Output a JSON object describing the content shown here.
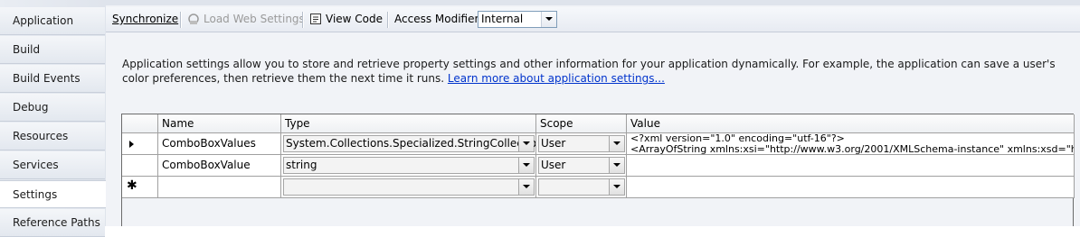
{
  "sidebar": {
    "items": [
      {
        "label": "Application"
      },
      {
        "label": "Build"
      },
      {
        "label": "Build Events"
      },
      {
        "label": "Debug"
      },
      {
        "label": "Resources"
      },
      {
        "label": "Services"
      },
      {
        "label": "Settings",
        "active": true
      },
      {
        "label": "Reference Paths"
      }
    ]
  },
  "toolbar": {
    "synchronize": "Synchronize",
    "load_web_settings": "Load Web Settings",
    "view_code": "View Code",
    "access_modifier_label": "Access Modifier:",
    "access_modifier_value": "Internal"
  },
  "description": {
    "text": "Application settings allow you to store and retrieve property settings and other information for your application dynamically. For example, the application can save a user's color preferences, then retrieve them the next time it runs.",
    "link": "Learn more about application settings..."
  },
  "grid": {
    "headers": {
      "name": "Name",
      "type": "Type",
      "scope": "Scope",
      "value": "Value"
    },
    "rows": [
      {
        "name": "ComboBoxValues",
        "type": "System.Collections.Specialized.StringCollection",
        "scope": "User",
        "value_line1": "<?xml version=\"1.0\" encoding=\"utf-16\"?>",
        "value_line2": "<ArrayOfString xmlns:xsi=\"http://www.w3.org/2001/XMLSchema-instance\" xmlns:xsd=\"ht"
      },
      {
        "name": "ComboBoxValue",
        "type": "string",
        "scope": "User",
        "value_line1": "",
        "value_line2": ""
      }
    ],
    "new_row_marker": "✱"
  },
  "colors": {
    "link": "#0033cc",
    "sidebar_bg": "#e3e8ef",
    "content_bg": "#f1f3f7"
  }
}
